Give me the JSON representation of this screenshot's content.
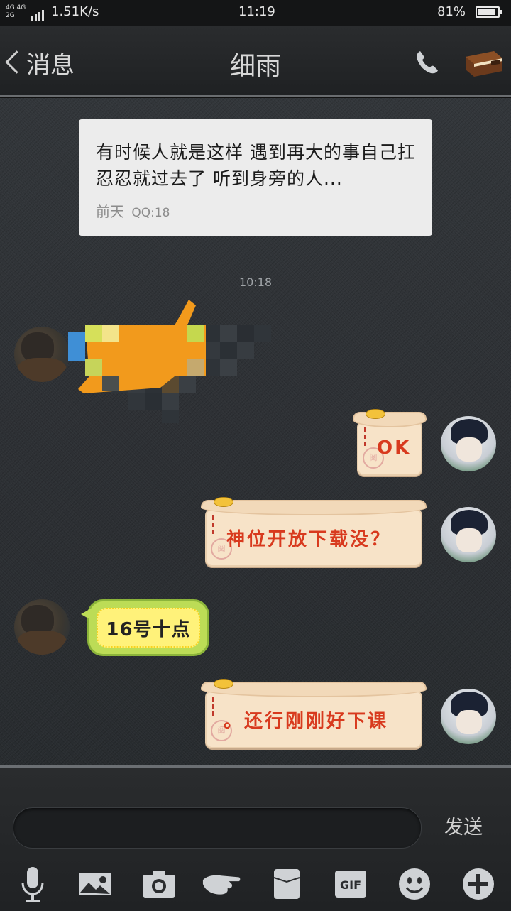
{
  "status_bar": {
    "network_top": "4G 4G",
    "network_bottom": "2G",
    "speed": "1.51K/s",
    "time": "11:19",
    "battery": "81%"
  },
  "header": {
    "back_label": "消息",
    "title": "细雨"
  },
  "shared_note": {
    "text": "有时候人就是这样 遇到再大的事自己扛忍忍就过去了 听到身旁的人...",
    "date": "前天",
    "time": "QQ:18"
  },
  "timestamp": "10:18",
  "messages": [
    {
      "side": "left",
      "type": "sticker-pixelated"
    },
    {
      "side": "right",
      "type": "scroll",
      "text": "OK"
    },
    {
      "side": "right",
      "type": "scroll",
      "text": "神位开放下载没？"
    },
    {
      "side": "left",
      "type": "lemon",
      "text": "16号十点"
    },
    {
      "side": "right",
      "type": "scroll",
      "text": "。还行刚刚好下课"
    }
  ],
  "scroll_seal": "阅",
  "input": {
    "send_label": "发送"
  },
  "toolbar": {
    "icons": [
      "microphone-icon",
      "photo-icon",
      "camera-icon",
      "poke-hand-icon",
      "folder-icon",
      "gif-icon",
      "emoji-icon",
      "plus-icon"
    ],
    "gif_label": "GIF"
  },
  "colors": {
    "scroll_text": "#d83a1e",
    "lemon": "#bcdc56"
  }
}
